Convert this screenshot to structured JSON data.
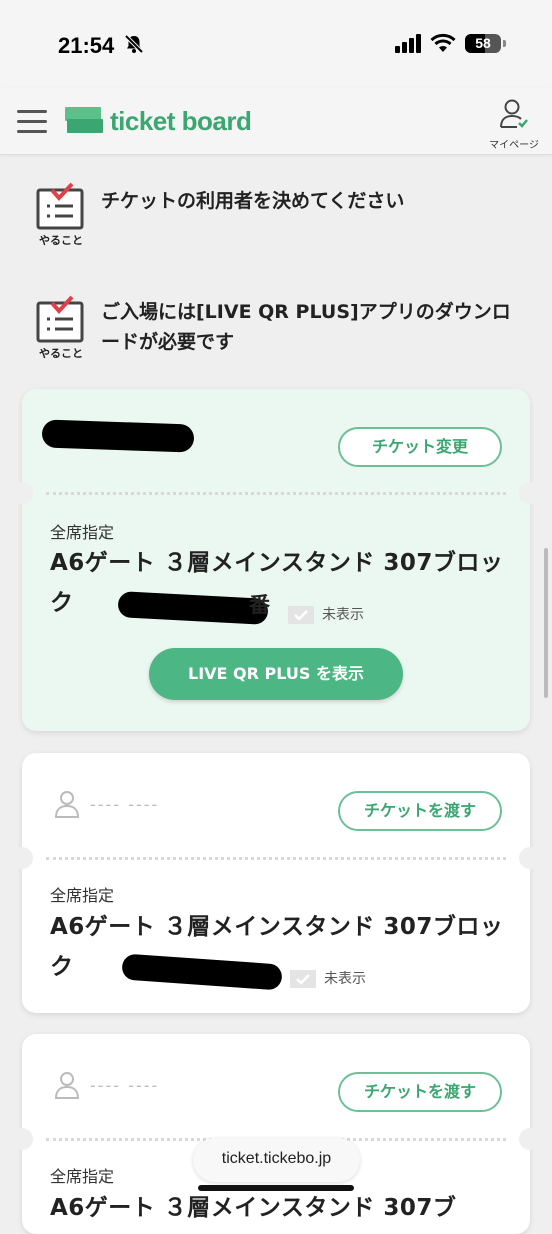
{
  "status_bar": {
    "time": "21:54",
    "battery": "58"
  },
  "header": {
    "logo_text": "ticket board",
    "mypage_label": "マイページ"
  },
  "todos": [
    {
      "label": "やること",
      "text": "チケットの利用者を決めてください"
    },
    {
      "label": "やること",
      "text": "ご入場には[LIVE QR PLUS]アプリのダウンロードが必要です"
    }
  ],
  "tickets": [
    {
      "action_label": "チケット変更",
      "seat_type": "全席指定",
      "seat_name": "A6ゲート ３層メインスタンド 307ブロック",
      "seat_suffix": "番",
      "hidden_label": "未表示",
      "qr_button": "LIVE QR PLUS を表示"
    },
    {
      "user_placeholder": "---- ----",
      "action_label": "チケットを渡す",
      "seat_type": "全席指定",
      "seat_name": "A6ゲート ３層メインスタンド 307ブロック",
      "hidden_label": "未表示"
    },
    {
      "user_placeholder": "---- ----",
      "action_label": "チケットを渡す",
      "seat_type": "全席指定",
      "seat_name": "A6ゲート ３層メインスタンド 307ブ"
    }
  ],
  "browser": {
    "url": "ticket.tickebo.jp"
  },
  "colors": {
    "brand_green": "#3ba671",
    "active_card_bg": "#ebf7f1",
    "qr_button_bg": "#4cb784"
  }
}
